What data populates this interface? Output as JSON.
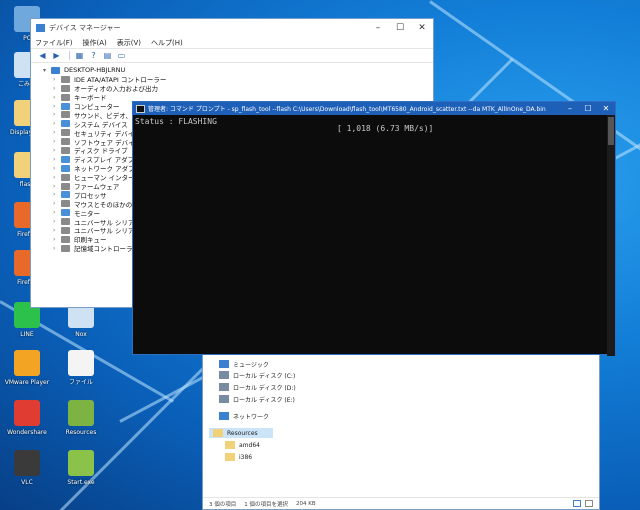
{
  "desktop": {
    "icons": [
      {
        "label": "PC",
        "icon": "computer-icon",
        "color": "#6fa8dc"
      },
      {
        "label": "ごみ箱",
        "icon": "recycle-bin-icon",
        "color": "#cfe2f3"
      },
      {
        "label": "DisplayDev",
        "icon": "folder-icon",
        "color": "#f1d27a"
      },
      {
        "label": "flash",
        "icon": "folder-icon",
        "color": "#f1d27a"
      },
      {
        "label": "Firefox",
        "icon": "firefox-icon",
        "color": "#e8692a"
      },
      {
        "label": "Firefox",
        "icon": "firefox-icon",
        "color": "#e8692a"
      },
      {
        "label": "LINE",
        "icon": "line-app-icon",
        "color": "#2cc14b"
      },
      {
        "label": "VMware Player",
        "icon": "vmware-icon",
        "color": "#f3a423"
      },
      {
        "label": "Wondershare",
        "icon": "wondershare-icon",
        "color": "#e03c31"
      },
      {
        "label": "VLC",
        "icon": "vlc-icon",
        "color": "#3a3a3a"
      },
      {
        "label": "Nox",
        "icon": "app-icon",
        "color": "#cfe2f3"
      },
      {
        "label": "ファイル",
        "icon": "file-icon",
        "color": "#f4f4f4"
      },
      {
        "label": "Resources",
        "icon": "folder-green-icon",
        "color": "#7cb342"
      },
      {
        "label": "Start.exe",
        "icon": "exe-icon",
        "color": "#8bc34a"
      }
    ]
  },
  "devmgr": {
    "title": "デバイス マネージャー",
    "menu": [
      "ファイル(F)",
      "操作(A)",
      "表示(V)",
      "ヘルプ(H)"
    ],
    "tree": [
      {
        "label": "DESKTOP-HBJLRNU",
        "expand": "▾",
        "color": "#3b7fd1"
      },
      {
        "label": "IDE ATA/ATAPI コントローラー",
        "expand": "›",
        "color": "#8a8a8a"
      },
      {
        "label": "オーディオの入力および出力",
        "expand": "›",
        "color": "#8a8a8a"
      },
      {
        "label": "キーボード",
        "expand": "›",
        "color": "#8a8a8a"
      },
      {
        "label": "コンピューター",
        "expand": "›",
        "color": "#4a90d9"
      },
      {
        "label": "サウンド、ビデオ、およびゲーム コントローラー",
        "expand": "›",
        "color": "#8a8a8a"
      },
      {
        "label": "システム デバイス",
        "expand": "›",
        "color": "#4a90d9"
      },
      {
        "label": "セキュリティ デバイス",
        "expand": "›",
        "color": "#8a8a8a"
      },
      {
        "label": "ソフトウェア デバイス",
        "expand": "›",
        "color": "#8a8a8a"
      },
      {
        "label": "ディスク ドライブ",
        "expand": "›",
        "color": "#8a8a8a"
      },
      {
        "label": "ディスプレイ アダプター",
        "expand": "›",
        "color": "#4a90d9"
      },
      {
        "label": "ネットワーク アダプター",
        "expand": "›",
        "color": "#4a90d9"
      },
      {
        "label": "ヒューマン インターフェイス デバイス",
        "expand": "›",
        "color": "#8a8a8a"
      },
      {
        "label": "ファームウェア",
        "expand": "›",
        "color": "#8a8a8a"
      },
      {
        "label": "プロセッサ",
        "expand": "›",
        "color": "#4a90d9"
      },
      {
        "label": "マウスとそのほかのポインティング デバイス",
        "expand": "›",
        "color": "#8a8a8a"
      },
      {
        "label": "モニター",
        "expand": "›",
        "color": "#4a90d9"
      },
      {
        "label": "ユニバーサル シリアル バス コントローラー",
        "expand": "›",
        "color": "#8a8a8a"
      },
      {
        "label": "ユニバーサル シリアル バス デバイス",
        "expand": "›",
        "color": "#8a8a8a"
      },
      {
        "label": "印刷キュー",
        "expand": "›",
        "color": "#8a8a8a"
      },
      {
        "label": "記憶域コントローラー",
        "expand": "›",
        "color": "#8a8a8a"
      }
    ]
  },
  "console": {
    "title": "管理者: コマンド プロンプト - sp_flash_tool --flash C:\\Users\\Download\\flash_tool\\MT6580_Android_scatter.txt --da MTK_AllInOne_DA.bin",
    "status": "Status : FLASHING",
    "progress": "[ 1,018 (6.73 MB/s)]"
  },
  "explorer": {
    "items": [
      {
        "label": "ミュージック",
        "icon": "music-icon",
        "color": "#3b7fd1",
        "selected": false
      },
      {
        "label": "ローカル ディスク (C:)",
        "icon": "drive-icon",
        "color": "#7a8aa0",
        "selected": false
      },
      {
        "label": "ローカル ディスク (D:)",
        "icon": "drive-icon",
        "color": "#7a8aa0",
        "selected": false
      },
      {
        "label": "ローカル ディスク (E:)",
        "icon": "drive-icon",
        "color": "#7a8aa0",
        "selected": false
      },
      {
        "label": "ネットワーク",
        "icon": "network-icon",
        "color": "#3b7fd1",
        "selected": false
      },
      {
        "label": "Resources",
        "icon": "folder-icon",
        "color": "#f1d27a",
        "selected": true
      },
      {
        "label": "amd64",
        "icon": "folder-icon",
        "color": "#f1d27a",
        "selected": false
      },
      {
        "label": "i386",
        "icon": "folder-icon",
        "color": "#f1d27a",
        "selected": false
      }
    ],
    "status": [
      "3 個の項目",
      "1 個の項目を選択",
      "204 KB"
    ]
  }
}
